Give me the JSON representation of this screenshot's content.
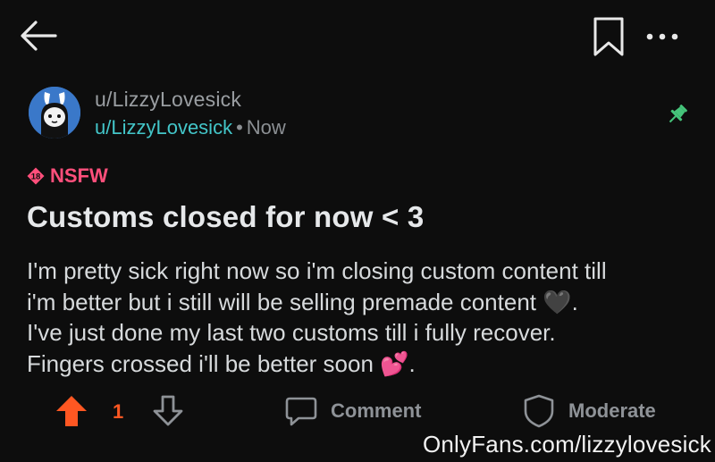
{
  "header": {
    "back_icon": "arrow-left-icon",
    "bookmark_icon": "bookmark-icon",
    "more_icon": "more-horizontal-icon"
  },
  "post": {
    "subreddit": "u/LizzyLovesick",
    "author": "u/LizzyLovesick",
    "separator": "•",
    "time": "Now",
    "nsfw_badge": "18",
    "nsfw_label": "NSFW",
    "title": "Customs closed for now < 3",
    "body_lines": [
      "I'm pretty sick right now so i'm closing custom content till",
      "i'm better but i still will be selling premade content 🖤.",
      "I've just done my last two customs till i fully recover.",
      "Fingers crossed i'll be better soon 💕."
    ]
  },
  "actions": {
    "vote_count": "1",
    "comment_label": "Comment",
    "moderate_label": "Moderate"
  },
  "colors": {
    "background": "#0d0d0d",
    "author": "#43c6c9",
    "nsfw": "#ff4f7b",
    "upvote": "#ff5722",
    "pin": "#45c47a"
  },
  "watermark": "OnlyFans.com/lizzylovesick"
}
